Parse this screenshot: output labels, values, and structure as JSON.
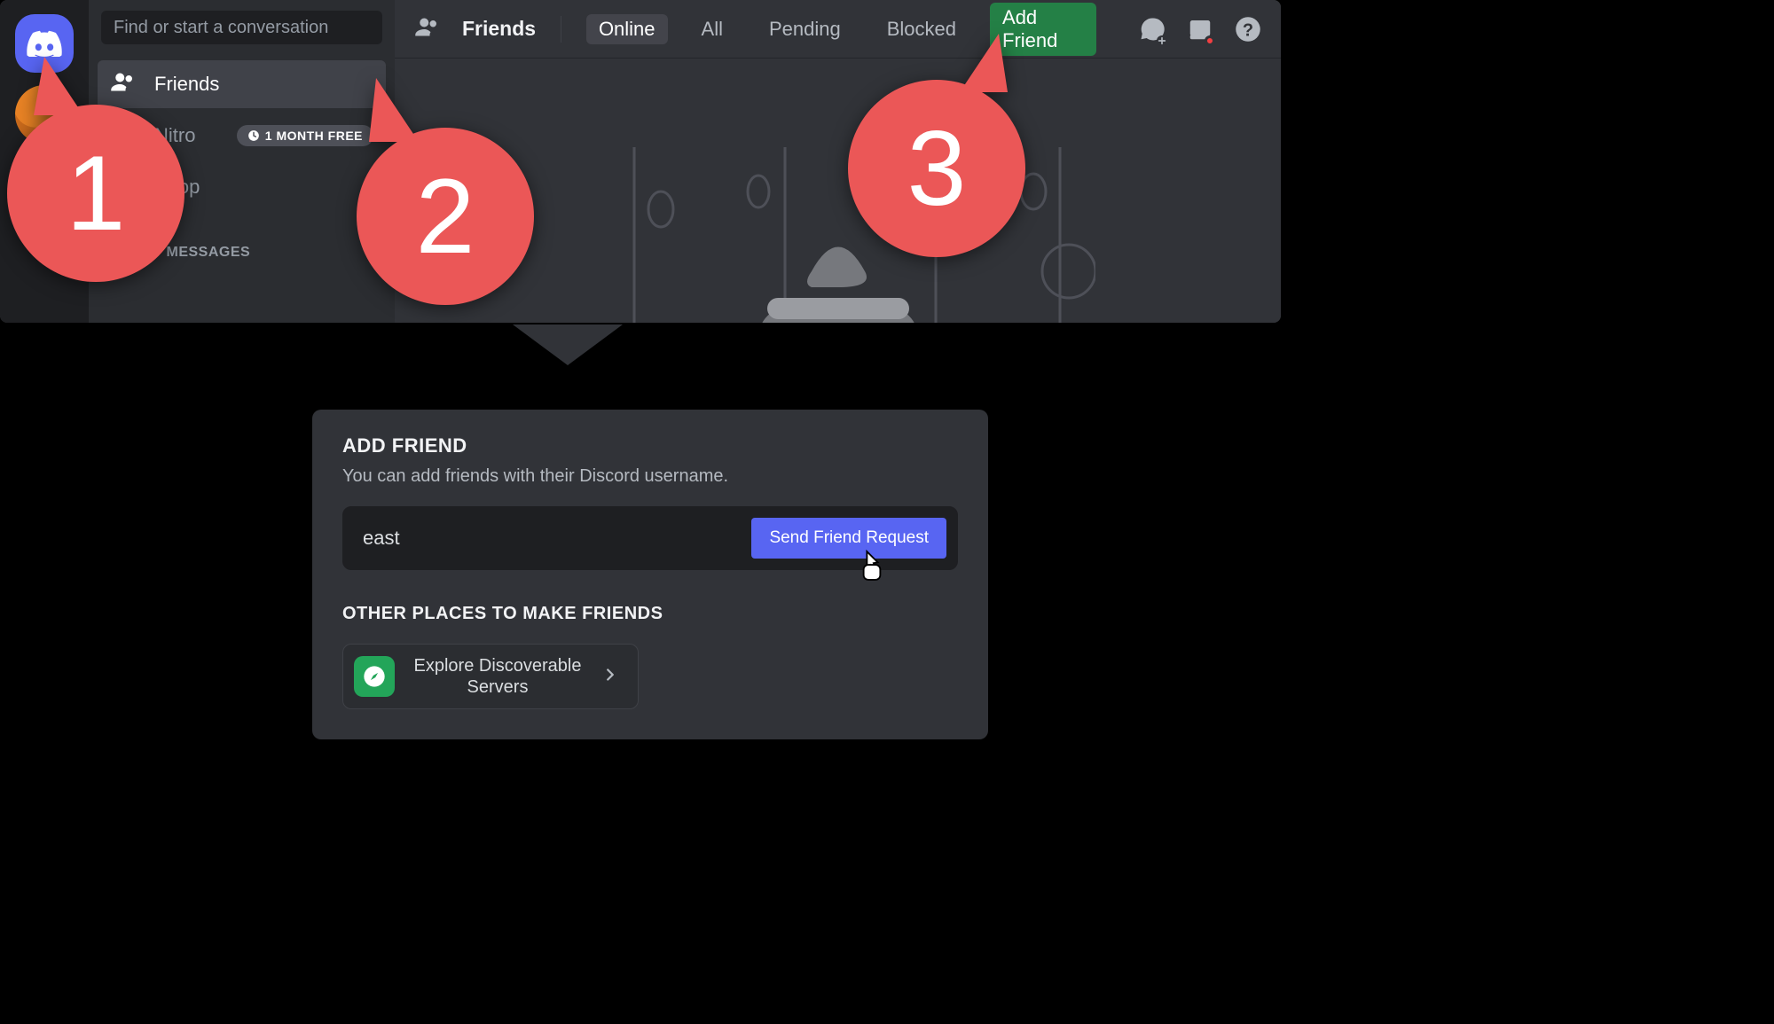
{
  "search": {
    "placeholder": "Find or start a conversation"
  },
  "nav": {
    "friends": "Friends",
    "nitro": "Nitro",
    "nitroBadge": "1 MONTH FREE",
    "shop": "Shop",
    "dmHeader": "DIRECT MESSAGES"
  },
  "topbar": {
    "title": "Friends",
    "tabs": {
      "online": "Online",
      "all": "All",
      "pending": "Pending",
      "blocked": "Blocked",
      "addFriend": "Add Friend"
    }
  },
  "addFriendPanel": {
    "title": "ADD FRIEND",
    "subtitle": "You can add friends with their Discord username.",
    "inputValue": "east",
    "sendLabel": "Send Friend Request",
    "otherTitle": "OTHER PLACES TO MAKE FRIENDS",
    "exploreLabel": "Explore Discoverable Servers"
  },
  "callouts": {
    "one": "1",
    "two": "2",
    "three": "3"
  },
  "icons": {
    "newGroup": "new-group-dm-icon",
    "inbox": "inbox-icon",
    "help": "help-icon"
  }
}
